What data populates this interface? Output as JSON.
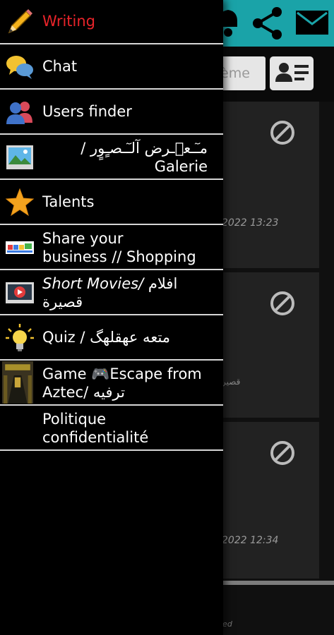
{
  "background": {
    "search_placeholder": "ème",
    "cards": [
      {
        "timestamp": "2022 13:23",
        "snippet": ""
      },
      {
        "timestamp": "",
        "snippet": "قصير"
      },
      {
        "timestamp": "2022 12:34",
        "snippet": ""
      }
    ],
    "footer_text": "led"
  },
  "drawer": {
    "items": [
      {
        "label": "Writing",
        "icon": "pencil-icon"
      },
      {
        "label": "Chat",
        "icon": "chat-bubbles-icon"
      },
      {
        "label": "Users finder",
        "icon": "users-icon"
      },
      {
        "label_line1": "مـٓـعٖـرض آلـٓـصـٍوٍر /",
        "label_line2": "Galerie",
        "icon": "gallery-icon"
      },
      {
        "label": "Talents",
        "icon": "star-icon"
      },
      {
        "label_line1": "Share your",
        "label_line2": "business // Shopping",
        "icon": "shopping-icon"
      },
      {
        "label_line1_italic": "Short Movies/",
        "label_line1_ar": "افلام",
        "label_line2": "قصيرة",
        "icon": "video-play-icon"
      },
      {
        "label": "Quiz / متعه عهقلهگ",
        "icon": "lightbulb-icon"
      },
      {
        "label_line1": "Game 🎮Escape from",
        "label_line2": "Aztec/ ترفيه",
        "icon": "game-thumbnail-icon"
      },
      {
        "label_line1": "Politique",
        "label_line2": "confidentialité",
        "icon": ""
      }
    ]
  },
  "colors": {
    "accent_red": "#e8242a",
    "teal_bar": "#1aa3a8",
    "divider": "#d6d6d6"
  }
}
